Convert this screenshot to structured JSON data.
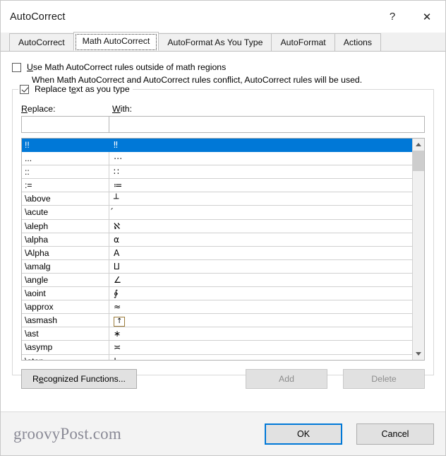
{
  "window": {
    "title": "AutoCorrect",
    "help_glyph": "?",
    "close_glyph": "✕"
  },
  "tabs": [
    {
      "label": "AutoCorrect",
      "selected": false
    },
    {
      "label": "Math AutoCorrect",
      "selected": true
    },
    {
      "label": "AutoFormat As You Type",
      "selected": false
    },
    {
      "label": "AutoFormat",
      "selected": false
    },
    {
      "label": "Actions",
      "selected": false
    }
  ],
  "options": {
    "use_math_rules": {
      "label_pre": "U",
      "label_post": "se Math AutoCorrect rules outside of math regions",
      "checked": false
    },
    "conflict_note": "When Math AutoCorrect and AutoCorrect rules conflict, AutoCorrect rules will be used.",
    "replace_text": {
      "label_pre": "Replace t",
      "label_mid": "e",
      "label_post": "xt as you type",
      "checked": true
    }
  },
  "fields": {
    "replace_label_pre": "R",
    "replace_label_post": "eplace:",
    "with_label_pre": "W",
    "with_label_post": "ith:",
    "replace_value": "",
    "with_value": "",
    "replace_placeholder": "",
    "with_placeholder": ""
  },
  "list": {
    "headers": [
      "Replace",
      "With"
    ],
    "selected_index": 0,
    "rows": [
      {
        "replace": "!!",
        "with": "‼",
        "boxed": false
      },
      {
        "replace": "...",
        "with": "⋯",
        "boxed": false
      },
      {
        "replace": "::",
        "with": "∷",
        "boxed": false
      },
      {
        "replace": ":=",
        "with": "≔",
        "boxed": false
      },
      {
        "replace": "\\above",
        "with": "┴",
        "boxed": false
      },
      {
        "replace": "\\acute",
        "with": "́",
        "boxed": false
      },
      {
        "replace": "\\aleph",
        "with": "ℵ",
        "boxed": false
      },
      {
        "replace": "\\alpha",
        "with": "α",
        "boxed": false
      },
      {
        "replace": "\\Alpha",
        "with": "Α",
        "boxed": false
      },
      {
        "replace": "\\amalg",
        "with": "⨿",
        "boxed": false
      },
      {
        "replace": "\\angle",
        "with": "∠",
        "boxed": false
      },
      {
        "replace": "\\aoint",
        "with": "∳",
        "boxed": false
      },
      {
        "replace": "\\approx",
        "with": "≈",
        "boxed": false
      },
      {
        "replace": "\\asmash",
        "with": "↑",
        "boxed": true
      },
      {
        "replace": "\\ast",
        "with": "∗",
        "boxed": false
      },
      {
        "replace": "\\asymp",
        "with": "≍",
        "boxed": false
      },
      {
        "replace": "\\atop",
        "with": "¦",
        "boxed": false
      }
    ]
  },
  "group_buttons": {
    "recognized_pre": "R",
    "recognized_mid": "e",
    "recognized_post": "cognized Functions...",
    "add": "Add",
    "add_enabled": false,
    "delete": "Delete",
    "delete_enabled": false
  },
  "footer": {
    "watermark": "groovyPost.com",
    "ok": "OK",
    "cancel": "Cancel"
  },
  "colors": {
    "accent": "#0078d7",
    "selection_bg": "#0078d7",
    "button_face": "#e1e1e1",
    "footer_bg": "#f3f3f3",
    "disabled_text": "#8d8d8d"
  }
}
